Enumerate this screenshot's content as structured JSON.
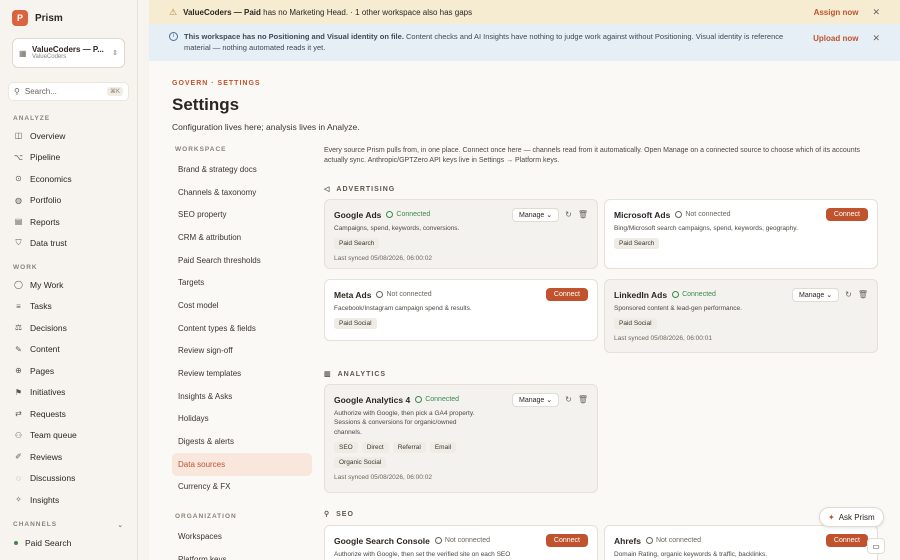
{
  "brand": {
    "logo": "P",
    "name": "Prism"
  },
  "workspace": {
    "name": "ValueCoders — P...",
    "sub": "ValueCoders"
  },
  "search": {
    "placeholder": "Search...",
    "shortcut": "⌘K"
  },
  "sidebar": {
    "analyze_label": "ANALYZE",
    "analyze": [
      {
        "label": "Overview",
        "icon": "grid-icon"
      },
      {
        "label": "Pipeline",
        "icon": "pipeline-icon"
      },
      {
        "label": "Economics",
        "icon": "economics-icon"
      },
      {
        "label": "Portfolio",
        "icon": "portfolio-icon"
      },
      {
        "label": "Reports",
        "icon": "reports-icon"
      },
      {
        "label": "Data trust",
        "icon": "shield-icon"
      }
    ],
    "work_label": "WORK",
    "work": [
      {
        "label": "My Work",
        "icon": "user-icon"
      },
      {
        "label": "Tasks",
        "icon": "tasks-icon"
      },
      {
        "label": "Decisions",
        "icon": "decisions-icon"
      },
      {
        "label": "Content",
        "icon": "content-icon"
      },
      {
        "label": "Pages",
        "icon": "pages-icon"
      },
      {
        "label": "Initiatives",
        "icon": "initiatives-icon"
      },
      {
        "label": "Requests",
        "icon": "requests-icon"
      },
      {
        "label": "Team queue",
        "icon": "team-icon"
      },
      {
        "label": "Reviews",
        "icon": "reviews-icon"
      },
      {
        "label": "Discussions",
        "icon": "discussions-icon"
      },
      {
        "label": "Insights",
        "icon": "insights-icon"
      }
    ],
    "channels_label": "CHANNELS",
    "channels": [
      {
        "label": "Paid Search"
      }
    ]
  },
  "banner1": {
    "strong": "ValueCoders — Paid",
    "text": " has no Marketing Head. · 1 other workspace also has gaps",
    "action": "Assign now"
  },
  "banner2": {
    "strong": "This workspace has no Positioning and Visual identity on file.",
    "text": " Content checks and AI Insights have nothing to judge work against without Positioning. Visual identity is reference material — nothing automated reads it yet.",
    "action": "Upload now"
  },
  "page": {
    "crumb": "GOVERN · SETTINGS",
    "title": "Settings",
    "subtitle": "Configuration lives here; analysis lives in Analyze."
  },
  "settings_nav": {
    "workspace_label": "WORKSPACE",
    "workspace": [
      "Brand & strategy docs",
      "Channels & taxonomy",
      "SEO property",
      "CRM & attribution",
      "Paid Search thresholds",
      "Targets",
      "Cost model",
      "Content types & fields",
      "Review sign-off",
      "Review templates",
      "Insights & Asks",
      "Holidays",
      "Digests & alerts",
      "Data sources",
      "Currency & FX"
    ],
    "active": "Data sources",
    "org_label": "ORGANIZATION",
    "org": [
      "Workspaces",
      "Platform keys"
    ]
  },
  "intro": "Every source Prism pulls from, in one place. Connect once here — channels read from it automatically. Open Manage on a connected source to choose which of its accounts actually sync. Anthropic/GPTZero API keys live in Settings → Platform keys.",
  "labels": {
    "connected": "Connected",
    "not_connected": "Not connected",
    "manage": "Manage",
    "connect": "Connect"
  },
  "groups": {
    "advertising": "ADVERTISING",
    "analytics": "ANALYTICS",
    "seo": "SEO"
  },
  "cards": {
    "google_ads": {
      "name": "Google Ads",
      "desc": "Campaigns, spend, keywords, conversions.",
      "tags": [
        "Paid Search"
      ],
      "synced": "Last synced 05/08/2026, 06:00:02"
    },
    "microsoft_ads": {
      "name": "Microsoft Ads",
      "desc": "Bing/Microsoft search campaigns, spend, keywords, geography.",
      "tags": [
        "Paid Search"
      ]
    },
    "meta_ads": {
      "name": "Meta Ads",
      "desc": "Facebook/Instagram campaign spend & results.",
      "tags": [
        "Paid Social"
      ]
    },
    "linkedin_ads": {
      "name": "LinkedIn Ads",
      "desc": "Sponsored content & lead-gen performance.",
      "tags": [
        "Paid Social"
      ],
      "synced": "Last synced 05/08/2026, 06:00:01"
    },
    "ga4": {
      "name": "Google Analytics 4",
      "desc": "Authorize with Google, then pick a GA4 property. Sessions & conversions for organic/owned channels.",
      "tags": [
        "SEO",
        "Direct",
        "Referral",
        "Email",
        "Organic Social"
      ],
      "synced": "Last synced 05/08/2026, 06:00:02"
    },
    "gsc": {
      "name": "Google Search Console",
      "desc": "Authorize with Google, then set the verified site on each SEO"
    },
    "ahrefs": {
      "name": "Ahrefs",
      "desc": "Domain Rating, organic keywords & traffic, backlinks."
    }
  },
  "ask": {
    "label": "Ask Prism"
  }
}
